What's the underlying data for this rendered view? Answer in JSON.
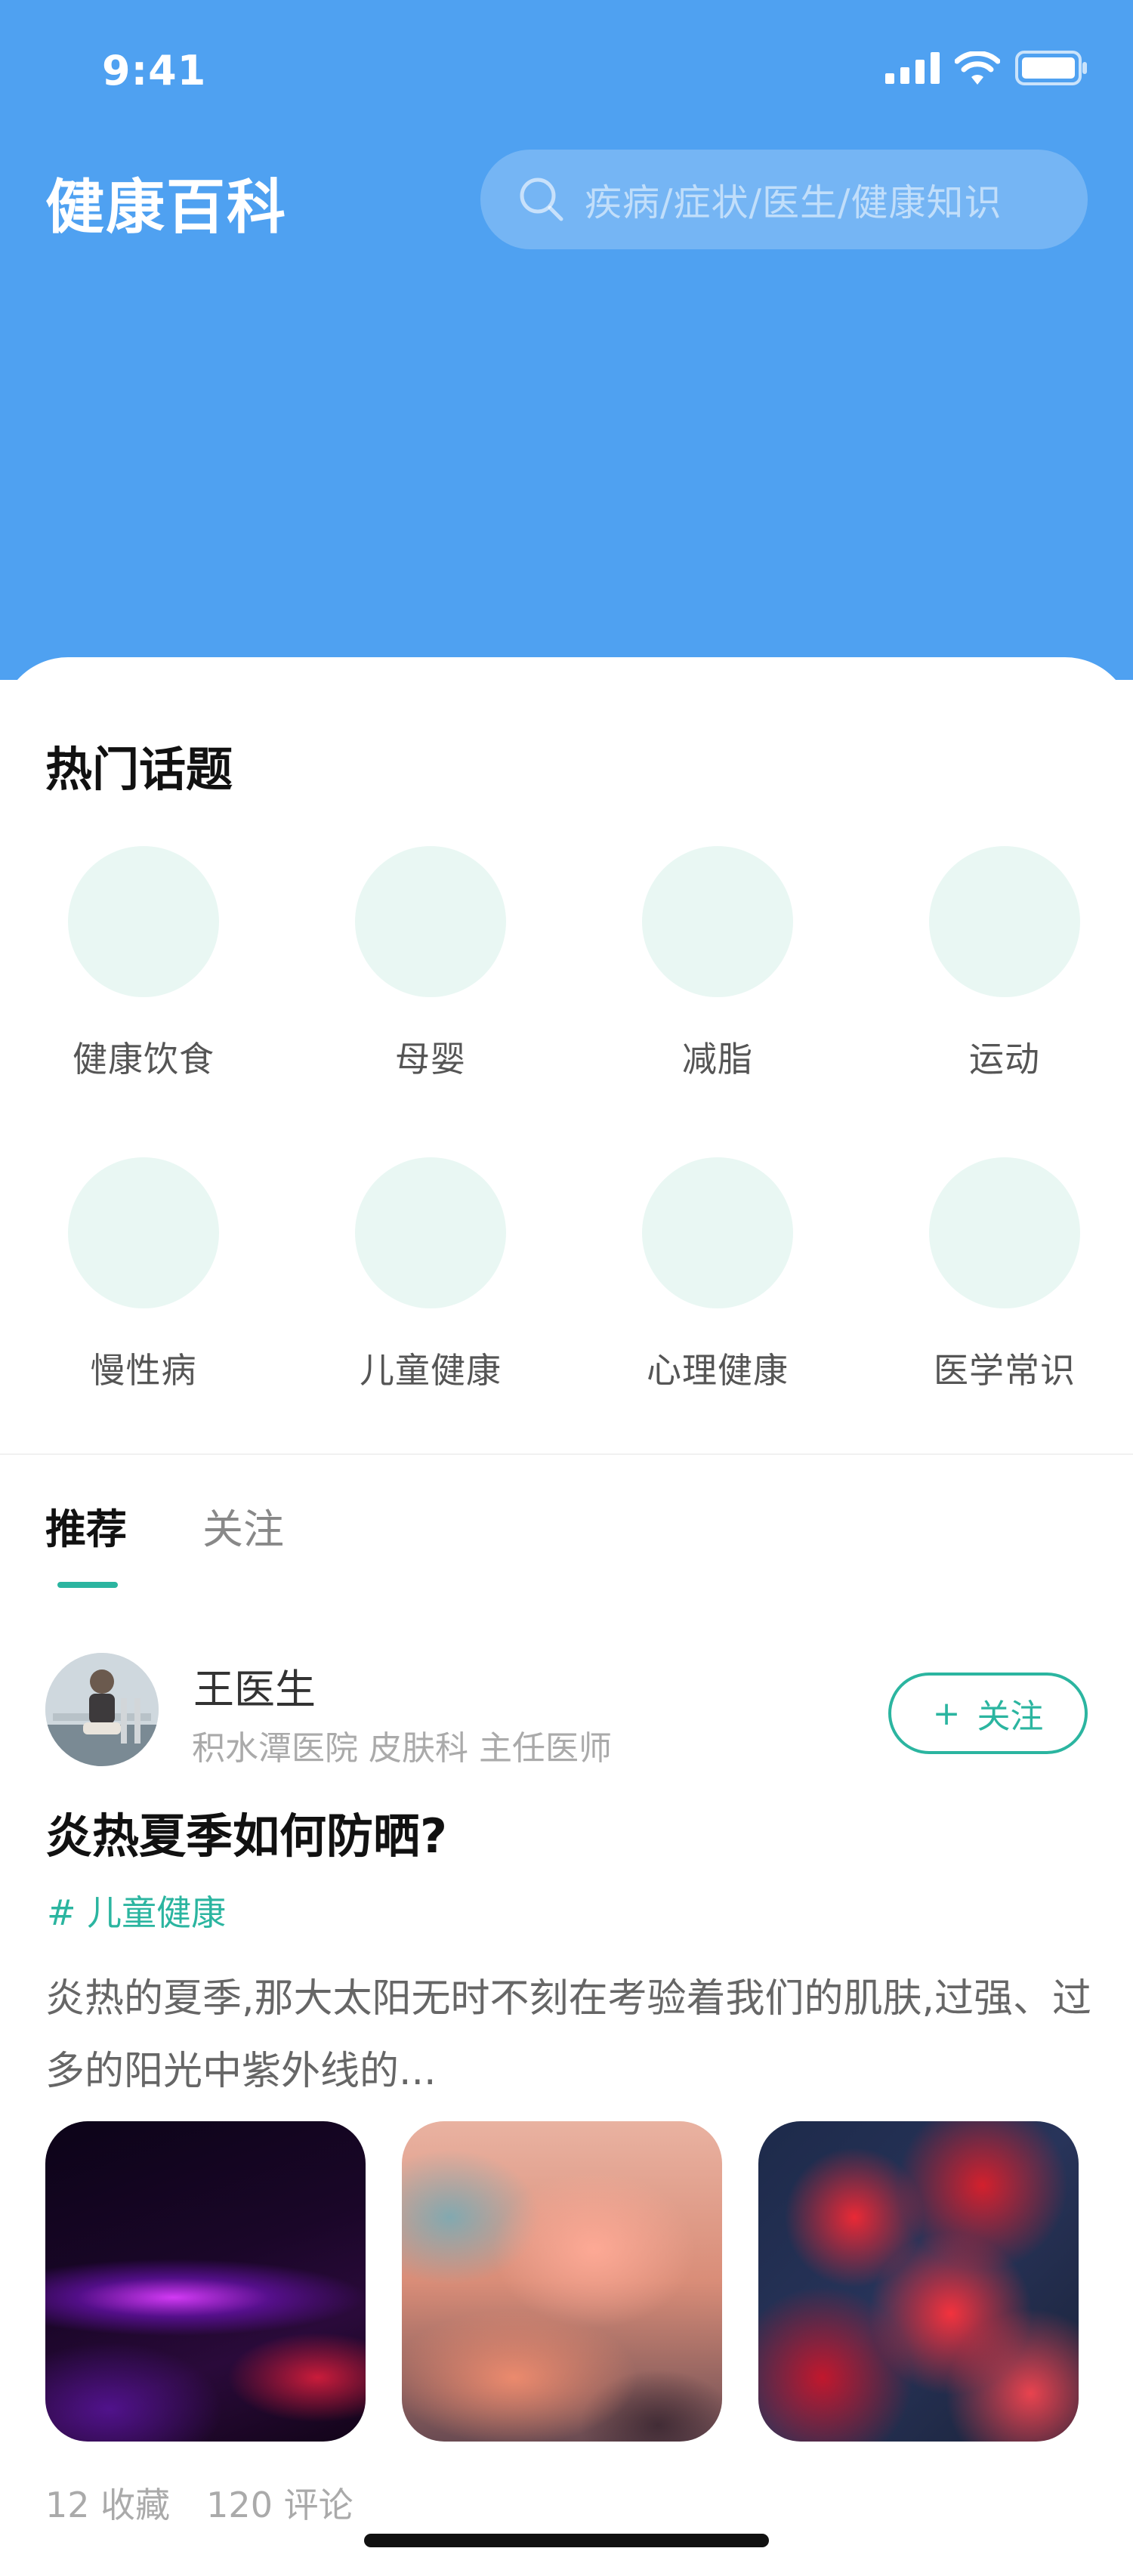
{
  "status_bar": {
    "time": "9:41"
  },
  "header": {
    "title": "健康百科",
    "search_placeholder": "疾病/症状/医生/健康知识"
  },
  "hot_topics": {
    "title": "热门话题",
    "items": [
      {
        "label": "健康饮食"
      },
      {
        "label": "母婴"
      },
      {
        "label": "减脂"
      },
      {
        "label": "运动"
      },
      {
        "label": "慢性病"
      },
      {
        "label": "儿童健康"
      },
      {
        "label": "心理健康"
      },
      {
        "label": "医学常识"
      }
    ]
  },
  "tabs": [
    {
      "label": "推荐"
    },
    {
      "label": "关注"
    }
  ],
  "post": {
    "author_name": "王医生",
    "author_info": "积水潭医院 皮肤科 主任医师",
    "follow_plus": "+",
    "follow_label": "关注",
    "title": "炎热夏季如何防晒?",
    "tag": "# 儿童健康",
    "excerpt": "炎热的夏季,那大太阳无时不刻在考验着我们的肌肤,过强、过多的阳光中紫外线的...",
    "favorites": "12 收藏",
    "comments": "120 评论"
  },
  "colors": {
    "hero_blue": "#4FA1F1",
    "accent_teal": "#2BB5A0",
    "topic_circle": "#E9F7F3"
  },
  "icons": [
    "signal-icon",
    "wifi-icon",
    "battery-icon",
    "search-icon"
  ]
}
